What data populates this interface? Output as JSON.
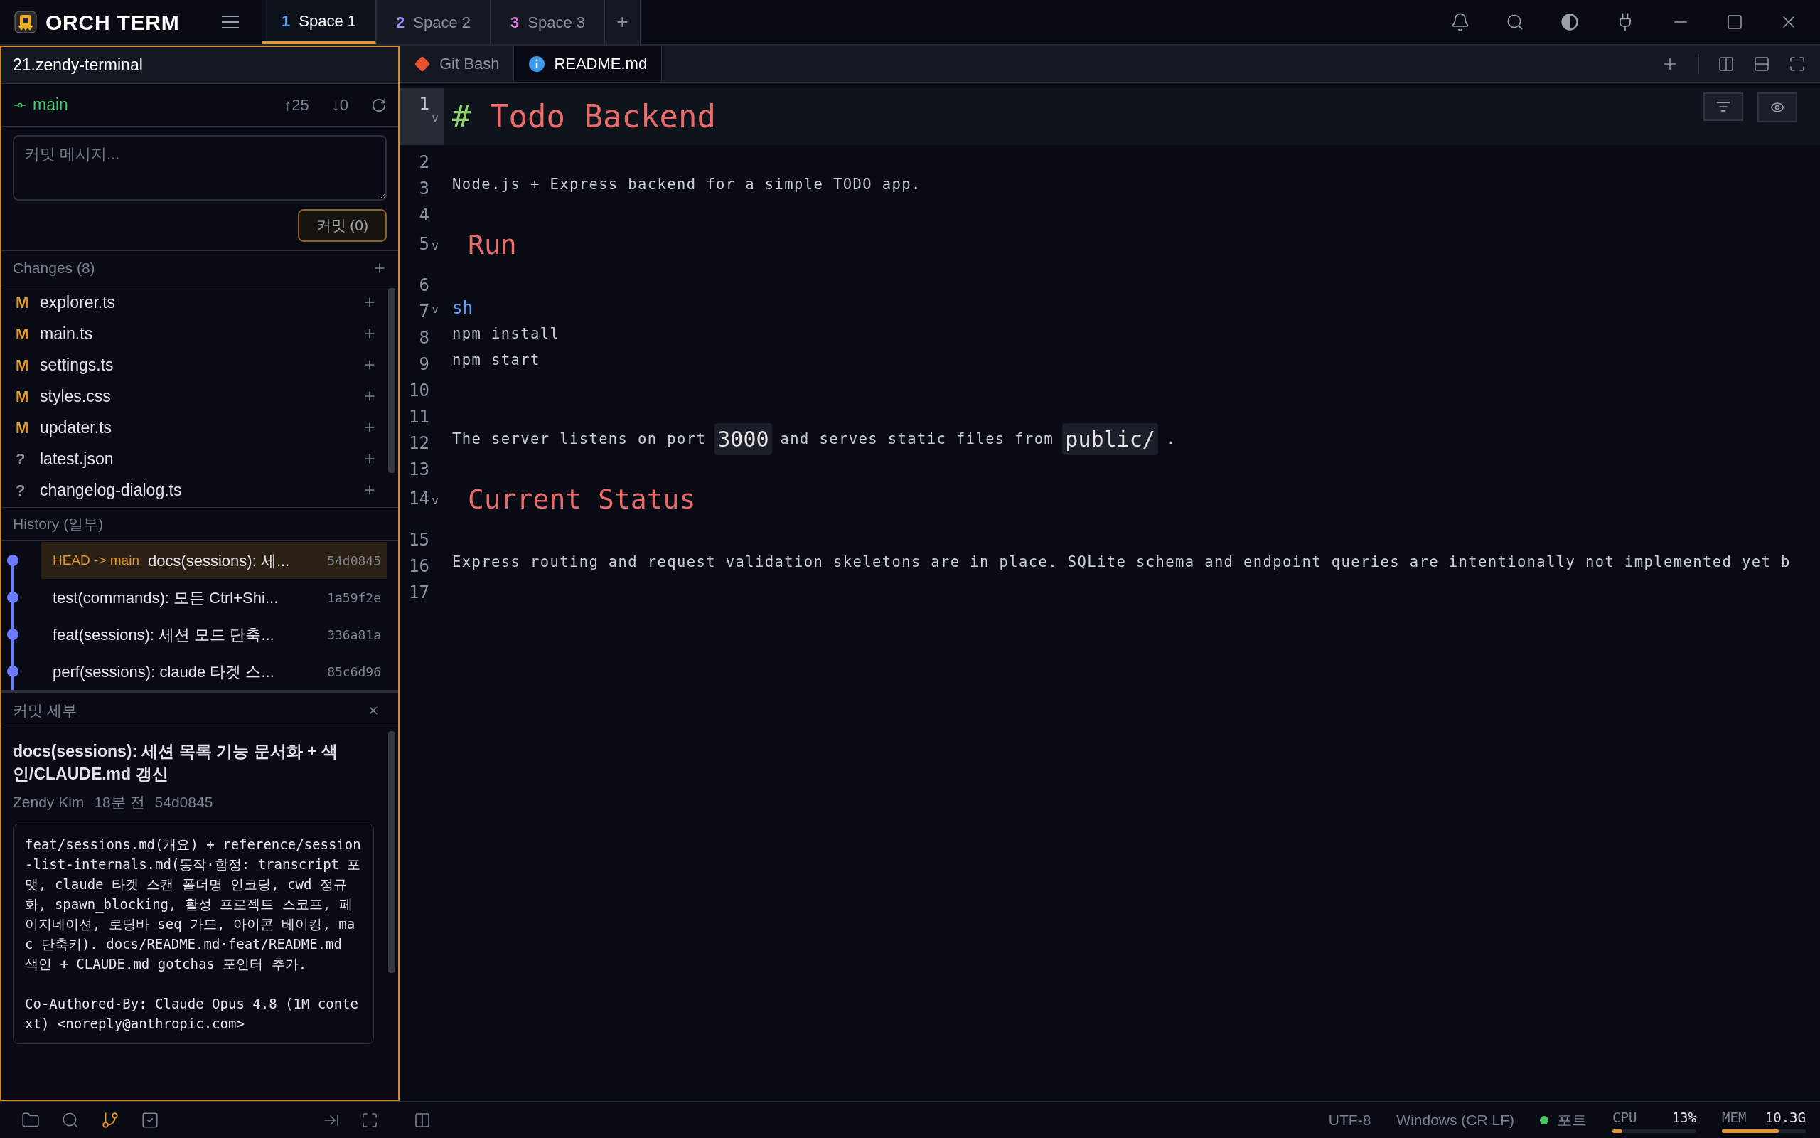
{
  "app": {
    "logo": "ORCH TERM"
  },
  "spaces": [
    {
      "number": "1",
      "label": "Space 1",
      "color": "#5aa2ff",
      "selected": true
    },
    {
      "number": "2",
      "label": "Space 2",
      "color": "#a08cff",
      "selected": false
    },
    {
      "number": "3",
      "label": "Space 3",
      "color": "#d67ad8",
      "selected": false
    }
  ],
  "new_space": "+",
  "sidebar": {
    "project": "21.zendy-terminal",
    "branch": {
      "name": "main",
      "ahead": "↑25",
      "behind": "↓0"
    },
    "commit_box": {
      "placeholder": "커밋 메시지...",
      "button": "커밋 (0)"
    },
    "changes": {
      "title": "Changes (8)",
      "files": [
        {
          "status": "M",
          "kind": "modified",
          "name": "explorer.ts"
        },
        {
          "status": "M",
          "kind": "modified",
          "name": "main.ts"
        },
        {
          "status": "M",
          "kind": "modified",
          "name": "settings.ts"
        },
        {
          "status": "M",
          "kind": "modified",
          "name": "styles.css"
        },
        {
          "status": "M",
          "kind": "modified",
          "name": "updater.ts"
        },
        {
          "status": "?",
          "kind": "untracked",
          "name": "latest.json"
        },
        {
          "status": "?",
          "kind": "untracked",
          "name": "changelog-dialog.ts"
        }
      ]
    },
    "history": {
      "title": "History (일부)",
      "commits": [
        {
          "ref": "HEAD -> main",
          "message": "docs(sessions): 세...",
          "hash": "54d0845",
          "selected": true
        },
        {
          "message": "test(commands): 모든 Ctrl+Shi...",
          "hash": "1a59f2e",
          "selected": false
        },
        {
          "message": "feat(sessions): 세션 모드 단축...",
          "hash": "336a81a",
          "selected": false
        },
        {
          "message": "perf(sessions): claude 타겟 스...",
          "hash": "85c6d96",
          "selected": false
        }
      ]
    },
    "details": {
      "title": "커밋 세부",
      "subject": "docs(sessions): 세션 목록 기능 문서화 + 색인/CLAUDE.md 갱신",
      "author": "Zendy Kim",
      "time": "18분 전",
      "hash": "54d0845",
      "body": "feat/sessions.md(개요) + reference/session-list-internals.md(동작·함정: transcript 포맷, claude 타겟 스캔 폴더명 인코딩, cwd 정규화, spawn_blocking, 활성 프로젝트 스코프, 페이지네이션, 로딩바 seq 가드, 아이콘 베이킹, mac 단축키). docs/README.md·feat/README.md 색인 + CLAUDE.md gotchas 포인터 추가.\n\nCo-Authored-By: Claude Opus 4.8 (1M context) <noreply@anthropic.com>"
    }
  },
  "editor": {
    "tabs": [
      {
        "label": "Git Bash",
        "kind": "git",
        "selected": false
      },
      {
        "label": "README.md",
        "kind": "info",
        "selected": true
      }
    ],
    "lines": [
      {
        "number": "1",
        "kind": "h1",
        "fold": "v",
        "current": true,
        "marker": "#",
        "text": "Todo Backend"
      },
      {
        "number": "2",
        "kind": "blank",
        "current": false
      },
      {
        "number": "3",
        "kind": "text",
        "current": false,
        "segments": [
          {
            "kind": "plain",
            "text": "Node.js + Express backend for a simple TODO app."
          }
        ]
      },
      {
        "number": "4",
        "kind": "blank",
        "current": false
      },
      {
        "number": "5",
        "kind": "h2",
        "fold": "v",
        "current": false,
        "text": "Run"
      },
      {
        "number": "6",
        "kind": "blank",
        "current": false
      },
      {
        "number": "7",
        "kind": "lang",
        "fold": "v",
        "current": false,
        "text": "sh"
      },
      {
        "number": "8",
        "kind": "text",
        "current": false,
        "segments": [
          {
            "kind": "plain",
            "text": "npm install"
          }
        ]
      },
      {
        "number": "9",
        "kind": "text",
        "current": false,
        "segments": [
          {
            "kind": "plain",
            "text": "npm start"
          }
        ]
      },
      {
        "number": "10",
        "kind": "blank",
        "current": false
      },
      {
        "number": "11",
        "kind": "blank",
        "current": false
      },
      {
        "number": "12",
        "kind": "text",
        "current": false,
        "segments": [
          {
            "kind": "plain",
            "text": "The server listens on port"
          },
          {
            "kind": "code",
            "text": "3000"
          },
          {
            "kind": "plain",
            "text": "and serves static files from"
          },
          {
            "kind": "code",
            "text": "public/"
          },
          {
            "kind": "plain",
            "text": "."
          }
        ]
      },
      {
        "number": "13",
        "kind": "blank",
        "current": false
      },
      {
        "number": "14",
        "kind": "h2",
        "fold": "v",
        "current": false,
        "text": "Current Status"
      },
      {
        "number": "15",
        "kind": "blank",
        "current": false
      },
      {
        "number": "16",
        "kind": "text",
        "current": false,
        "segments": [
          {
            "kind": "plain",
            "text": "Express routing and request validation skeletons are in place. SQLite schema and endpoint queries are intentionally not implemented yet b"
          }
        ]
      },
      {
        "number": "17",
        "kind": "blank",
        "current": false
      }
    ]
  },
  "status_bar": {
    "encoding": "UTF-8",
    "line_ending": "Windows (CR LF)",
    "ports": "포트",
    "cpu": {
      "label": "CPU",
      "value": "13%",
      "level": 0.12
    },
    "mem": {
      "label": "MEM",
      "value": "10.3G",
      "level": 0.68
    }
  }
}
